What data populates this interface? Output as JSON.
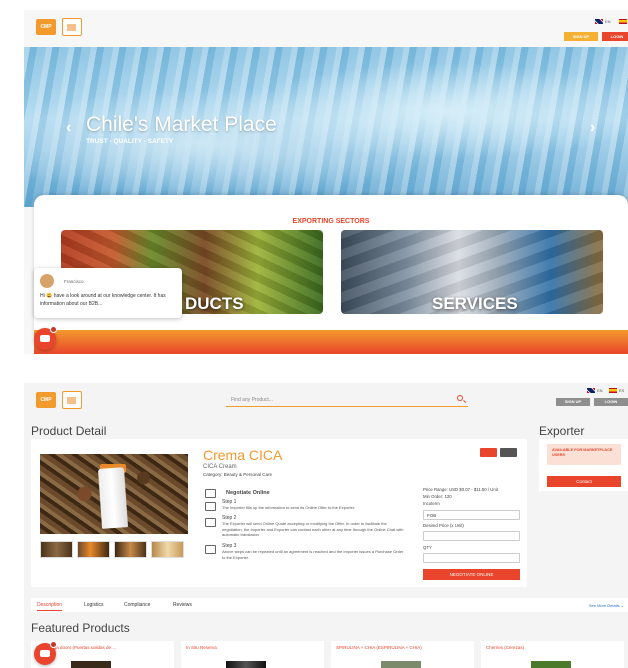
{
  "top": {
    "logo_text": "CMP",
    "lang_en": "EN",
    "lang_es": "ES",
    "signup": "SIGN UP",
    "login": "LOGIN",
    "hero_title": "Chile's Market Place",
    "hero_subtitle": "TRUST - QUALITY - SAFETY",
    "prev_arrow": "‹",
    "next_arrow": "›",
    "sectors_title": "EXPORTING SECTORS",
    "products_label": "PRODUCTS",
    "products_label_visible": "DUCTS",
    "services_label": "SERVICES",
    "chat": {
      "name": "Francisco",
      "message": "Hi 😀 have a look around at our knowledge center. It has information about our B2B..."
    }
  },
  "bottom": {
    "logo_text": "CMP",
    "search_placeholder": "Find any Product...",
    "lang_en": "EN",
    "lang_es": "ES",
    "signup": "SIGN UP",
    "login": "LOGIN",
    "product_detail_title": "Product Detail",
    "exporter_title": "Exporter",
    "product": {
      "name": "Crema CICA",
      "subtitle": "CICA Cream",
      "category": "Category: Beauty & Personal Care",
      "negotiate_title": "Negotiate Online",
      "step1_h": "Step 1",
      "step1_t": "The Importer fills up the information to send its Online Offer to the Exporter.",
      "step2_h": "Step 2",
      "step2_t": "The Exporter will send Online Quote accepting or modifying the Offer. In order to facilitate the negotiation, the Importer and Exporter can contact each other at any time through the Online Chat with automatic translation",
      "step3_h": "Step 3",
      "step3_t": "Above steps can be repeated until an agreement is reached and the Importer issues a Purchase Order to the Exporter.",
      "price_range": "Price Range: USD $0.07 - $11.50 / Unit",
      "min_order": "Min Order: 120",
      "incoterm_label": "Incoterm",
      "incoterm_value": "FOB",
      "desired_price_label": "Desired Price (x Unit)",
      "qty_label": "QTY",
      "negotiate_button": "NEGOTIATE ONLINE"
    },
    "exporter": {
      "available": "AVAILABLE FOR MARKETPLACE USERS",
      "contact": "Contact"
    },
    "tabs": [
      "Description",
      "Logistics",
      "Compliance",
      "Reviews"
    ],
    "see_more": "See More Details ⌄",
    "featured_title": "Featured Products",
    "featured": [
      "Seed lenga doors (Puertas solidas de ...",
      "In Situ Reserva",
      "SPIRULINA + CHIA (ESPIRULINA + CHIA)",
      "Cherries (Cerezas)"
    ]
  },
  "colors": {
    "accent_orange": "#f39a2d",
    "accent_red": "#e8452c"
  }
}
